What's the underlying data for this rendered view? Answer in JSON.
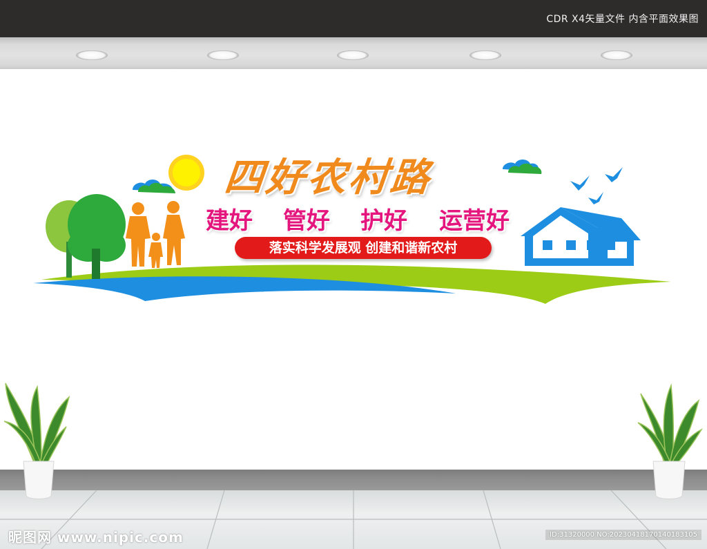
{
  "header": {
    "caption": "CDR X4矢量文件  内含平面效果图"
  },
  "signboard": {
    "title": "四好农村路",
    "slogans": [
      "建好",
      "管好",
      "护好",
      "运营好"
    ],
    "banner": "落实科学发展观  创建和谐新农村"
  },
  "watermarks": {
    "left": "昵图网 www.nipic.com",
    "right": "ID:31320000 NO:20230418170140183105"
  },
  "colors": {
    "title": "#f08a1c",
    "slogan": "#e5157e",
    "banner": "#e21a1a",
    "house": "#1e8fe0",
    "tree": "#2eaa3c",
    "people": "#f39019",
    "river": "#1e8fe0",
    "grass": "#9ccc16"
  }
}
